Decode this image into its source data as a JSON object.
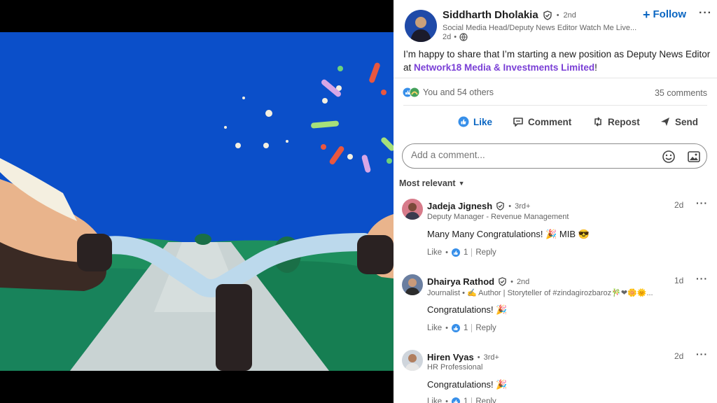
{
  "post": {
    "author": "Siddharth Dholakia",
    "degree": "2nd",
    "headline": "Social Media Head/Deputy News Editor Watch Me Live...",
    "time": "2d",
    "follow_label": "Follow",
    "text_before": "I’m happy to share that I’m starting a new position as Deputy News Editor at ",
    "company_link": "Network18 Media & Investments Limited",
    "text_after": "!",
    "reactions": "You and 54 others",
    "comments_count": "35 comments"
  },
  "actions": {
    "like": "Like",
    "comment": "Comment",
    "repost": "Repost",
    "send": "Send"
  },
  "comment_input": {
    "placeholder": "Add a comment..."
  },
  "sort": {
    "label": "Most relevant"
  },
  "comments": [
    {
      "name": "Jadeja Jignesh",
      "degree": "3rd+",
      "headline": "Deputy Manager - Revenue Management",
      "time": "2d",
      "text": "Many Many Congratulations! 🎉 MIB 😎",
      "like": "Like",
      "like_count": "1",
      "reply": "Reply"
    },
    {
      "name": "Dhairya Rathod",
      "degree": "2nd",
      "headline": "Journalist • ✍ Author | Storyteller of #zindagirozbaroz🎋❤🌼🌞...",
      "time": "1d",
      "text": "Congratulations! 🎉",
      "like": "Like",
      "like_count": "1",
      "reply": "Reply"
    },
    {
      "name": "Hiren Vyas",
      "degree": "3rd+",
      "headline": "HR Professional",
      "time": "2d",
      "text": "Congratulations! 🎉",
      "like": "Like",
      "like_count": "1",
      "reply": "Reply"
    }
  ],
  "colors": {
    "sky": "#0b4fc9",
    "accent": "#0a66c2",
    "link": "#7a3fd6",
    "grass": "#1e8f5e"
  }
}
